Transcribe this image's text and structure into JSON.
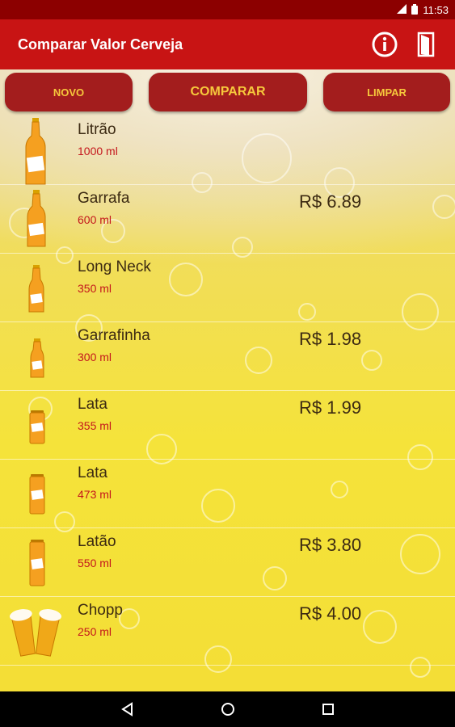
{
  "status": {
    "time": "11:53"
  },
  "appbar": {
    "title": "Comparar Valor Cerveja",
    "info_icon": "info-icon",
    "exit_icon": "exit-door-icon",
    "color": "#c81414"
  },
  "buttons": {
    "novo": "NOVO",
    "comparar": "COMPARAR",
    "limpar": "LIMPAR"
  },
  "items": [
    {
      "name": "Litrão",
      "size": "1000 ml",
      "price": "",
      "icon": "bottle-litrao-icon"
    },
    {
      "name": "Garrafa",
      "size": "600 ml",
      "price": "R$ 6.89",
      "icon": "bottle-600-icon"
    },
    {
      "name": "Long Neck",
      "size": "350 ml",
      "price": "",
      "icon": "long-neck-icon"
    },
    {
      "name": "Garrafinha",
      "size": "300 ml",
      "price": "R$ 1.98",
      "icon": "small-bottle-icon"
    },
    {
      "name": "Lata",
      "size": "355 ml",
      "price": "R$ 1.99",
      "icon": "can-355-icon"
    },
    {
      "name": "Lata",
      "size": "473 ml",
      "price": "",
      "icon": "can-473-icon"
    },
    {
      "name": "Latão",
      "size": "550 ml",
      "price": "R$ 3.80",
      "icon": "can-550-icon"
    },
    {
      "name": "Chopp",
      "size": "250 ml",
      "price": "R$ 4.00",
      "icon": "chopp-glasses-icon"
    }
  ],
  "colors": {
    "button_bg": "#a31d1d",
    "button_text": "#f6c83c",
    "size_text": "#c4161c"
  }
}
